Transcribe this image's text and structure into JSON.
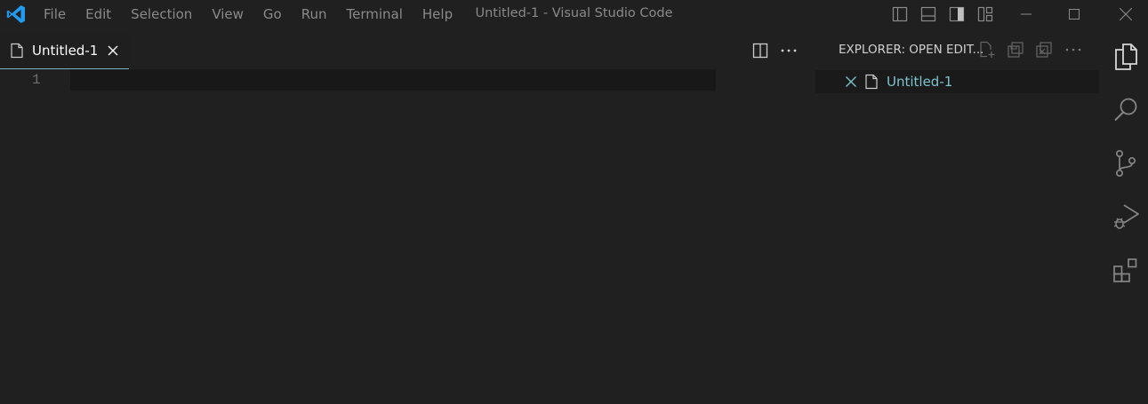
{
  "app": {
    "window_title": "Untitled-1 - Visual Studio Code",
    "logo_icon": "vscode-logo",
    "accent_color": "#0098ff"
  },
  "menu": [
    "File",
    "Edit",
    "Selection",
    "View",
    "Go",
    "Run",
    "Terminal",
    "Help"
  ],
  "layout_controls": [
    "toggle-primary-sidebar-icon",
    "toggle-panel-icon",
    "toggle-secondary-sidebar-icon",
    "customize-layout-icon"
  ],
  "window_controls": [
    "minimize-icon",
    "maximize-icon",
    "close-icon"
  ],
  "editor": {
    "active_tab": {
      "label": "Untitled-1",
      "icon": "file-icon"
    },
    "actions": [
      "split-editor-icon",
      "more-actions-icon"
    ],
    "line_numbers": [
      "1"
    ]
  },
  "open_editors": {
    "title": "EXPLORER: OPEN EDIT...",
    "actions": [
      "new-untitled-file-icon",
      "save-all-icon",
      "close-all-icon",
      "more-actions-icon"
    ],
    "items": [
      {
        "label": "Untitled-1",
        "icon": "file-icon",
        "color": "#7cc3ce"
      }
    ]
  },
  "activity_bar": [
    "explorer-icon",
    "search-icon",
    "source-control-icon",
    "run-and-debug-icon",
    "extensions-icon"
  ]
}
